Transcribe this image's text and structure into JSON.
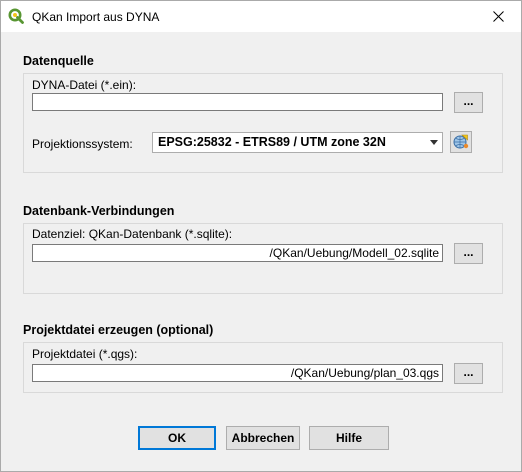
{
  "window": {
    "title": "QKan Import aus DYNA"
  },
  "sections": {
    "datenquelle": {
      "title": "Datenquelle",
      "dyna_label": "DYNA-Datei (*.ein):",
      "dyna_value": "",
      "browse_label": "...",
      "crs_label": "Projektionssystem:",
      "crs_value": "EPSG:25832 - ETRS89 / UTM zone 32N"
    },
    "datenbank": {
      "title": "Datenbank-Verbindungen",
      "ziel_label": "Datenziel: QKan-Datenbank (*.sqlite):",
      "ziel_value": "/QKan/Uebung/Modell_02.sqlite",
      "browse_label": "..."
    },
    "projekt": {
      "title": "Projektdatei erzeugen (optional)",
      "datei_label": "Projektdatei (*.qgs):",
      "datei_value": "/QKan/Uebung/plan_03.qgs",
      "browse_label": "..."
    }
  },
  "buttons": {
    "ok": "OK",
    "abbrechen": "Abbrechen",
    "hilfe": "Hilfe"
  },
  "icons": {
    "app": "qgis-logo-icon",
    "close": "close-icon",
    "crs": "globe-crs-icon"
  },
  "colors": {
    "accent": "#0078d7",
    "qgis_green": "#589632",
    "qgis_yellow": "#f0c419"
  }
}
